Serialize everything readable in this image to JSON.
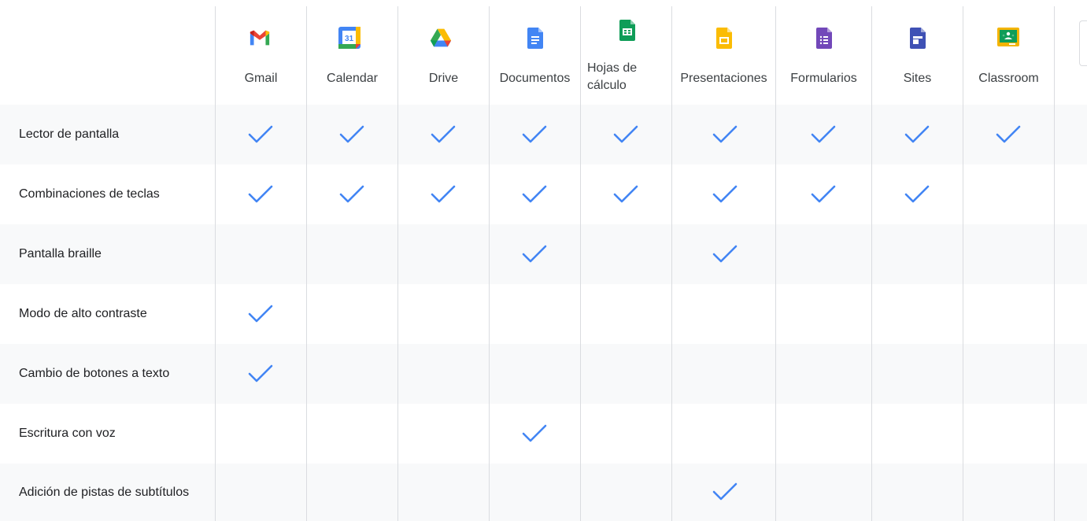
{
  "columns": [
    {
      "label": "Gmail",
      "icon": "gmail-icon"
    },
    {
      "label": "Calendar",
      "icon": "calendar-icon",
      "icon_text": "31"
    },
    {
      "label": "Drive",
      "icon": "drive-icon"
    },
    {
      "label": "Documentos",
      "icon": "docs-icon"
    },
    {
      "label": "Hojas de cálculo",
      "icon": "sheets-icon"
    },
    {
      "label": "Presentaciones",
      "icon": "slides-icon"
    },
    {
      "label": "Formularios",
      "icon": "forms-icon"
    },
    {
      "label": "Sites",
      "icon": "sites-icon"
    },
    {
      "label": "Classroom",
      "icon": "classroom-icon"
    }
  ],
  "rows": [
    {
      "label": "Lector de pantalla",
      "checks": [
        true,
        true,
        true,
        true,
        true,
        true,
        true,
        true,
        true
      ]
    },
    {
      "label": "Combinaciones de teclas",
      "checks": [
        true,
        true,
        true,
        true,
        true,
        true,
        true,
        true,
        false
      ]
    },
    {
      "label": "Pantalla braille",
      "checks": [
        false,
        false,
        false,
        true,
        false,
        true,
        false,
        false,
        false
      ]
    },
    {
      "label": "Modo de alto contraste",
      "checks": [
        true,
        false,
        false,
        false,
        false,
        false,
        false,
        false,
        false
      ]
    },
    {
      "label": "Cambio de botones a texto",
      "checks": [
        true,
        false,
        false,
        false,
        false,
        false,
        false,
        false,
        false
      ]
    },
    {
      "label": "Escritura con voz",
      "checks": [
        false,
        false,
        false,
        true,
        false,
        false,
        false,
        false,
        false
      ]
    },
    {
      "label": "Adición de pistas de subtítulos",
      "checks": [
        false,
        false,
        false,
        false,
        false,
        true,
        false,
        false,
        false
      ]
    }
  ],
  "colors": {
    "check": "#4285f4",
    "row_shade": "#f8f9fa",
    "grid": "#dadce0"
  }
}
